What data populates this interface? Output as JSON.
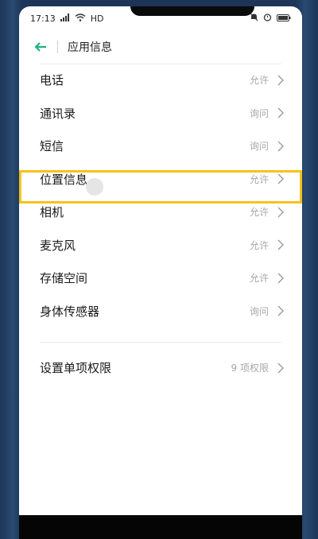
{
  "status_bar": {
    "time": "17:13",
    "network": "HD"
  },
  "header": {
    "title": "应用信息"
  },
  "permissions": [
    {
      "label": "电话",
      "value": "允许"
    },
    {
      "label": "通讯录",
      "value": "询问"
    },
    {
      "label": "短信",
      "value": "询问"
    },
    {
      "label": "位置信息",
      "value": "允许"
    },
    {
      "label": "相机",
      "value": "允许"
    },
    {
      "label": "麦克风",
      "value": "允许"
    },
    {
      "label": "存储空间",
      "value": "允许"
    },
    {
      "label": "身体传感器",
      "value": "询问"
    }
  ],
  "settings_item": {
    "label": "设置单项权限",
    "value": "9 项权限"
  },
  "colors": {
    "accent": "#1fb37a",
    "highlight": "#f5c31b"
  }
}
